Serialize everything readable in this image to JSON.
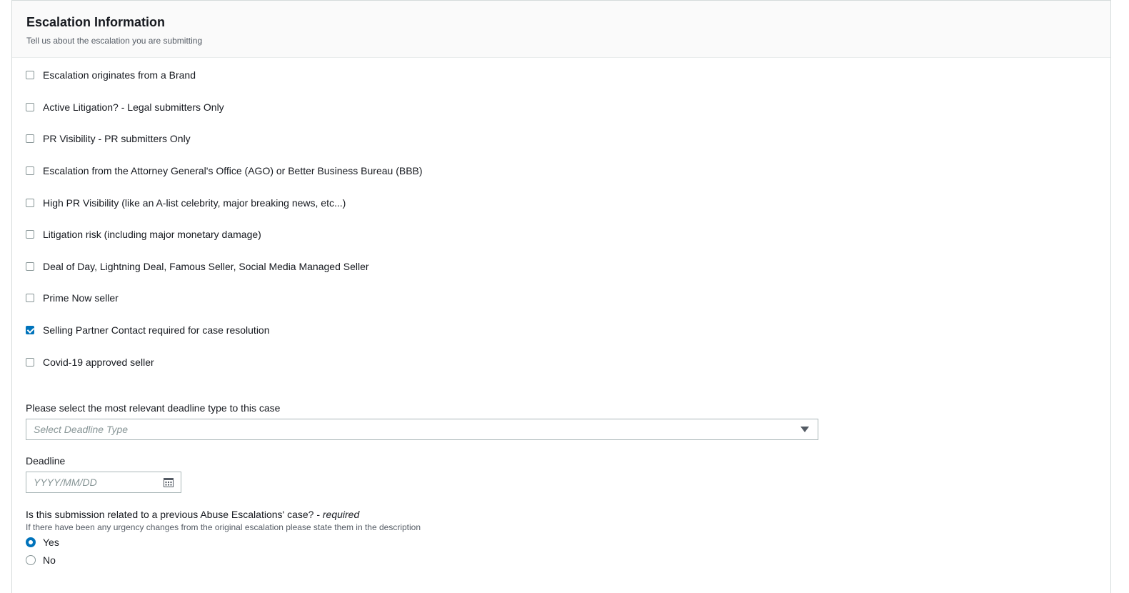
{
  "section": {
    "title": "Escalation Information",
    "description": "Tell us about the escalation you are submitting"
  },
  "checkboxes": [
    {
      "label": "Escalation originates from a Brand",
      "checked": false
    },
    {
      "label": "Active Litigation? - Legal submitters Only",
      "checked": false
    },
    {
      "label": "PR Visibility - PR submitters Only",
      "checked": false
    },
    {
      "label": "Escalation from the Attorney General's Office (AGO) or Better Business Bureau (BBB)",
      "checked": false
    },
    {
      "label": "High PR Visibility (like an A-list celebrity, major breaking news, etc...)",
      "checked": false
    },
    {
      "label": "Litigation risk (including major monetary damage)",
      "checked": false
    },
    {
      "label": "Deal of Day, Lightning Deal, Famous Seller, Social Media Managed Seller",
      "checked": false
    },
    {
      "label": "Prime Now seller",
      "checked": false
    },
    {
      "label": "Selling Partner Contact required for case resolution",
      "checked": true
    },
    {
      "label": "Covid-19 approved seller",
      "checked": false
    }
  ],
  "deadline_type": {
    "label": "Please select the most relevant deadline type to this case",
    "placeholder": "Select Deadline Type"
  },
  "deadline": {
    "label": "Deadline",
    "placeholder": "YYYY/MM/DD",
    "value": ""
  },
  "previous_case": {
    "question": "Is this submission related to a previous Abuse Escalations' case? - ",
    "required_label": "required",
    "description": "If there have been any urgency changes from the original escalation please state them in the description",
    "options": [
      {
        "label": "Yes",
        "selected": true
      },
      {
        "label": "No",
        "selected": false
      }
    ]
  },
  "colors": {
    "accent": "#0073bb",
    "border": "#aab7b8",
    "header_bg": "#fafafa"
  },
  "icons": [
    "calendar-icon",
    "caret-down-icon"
  ]
}
